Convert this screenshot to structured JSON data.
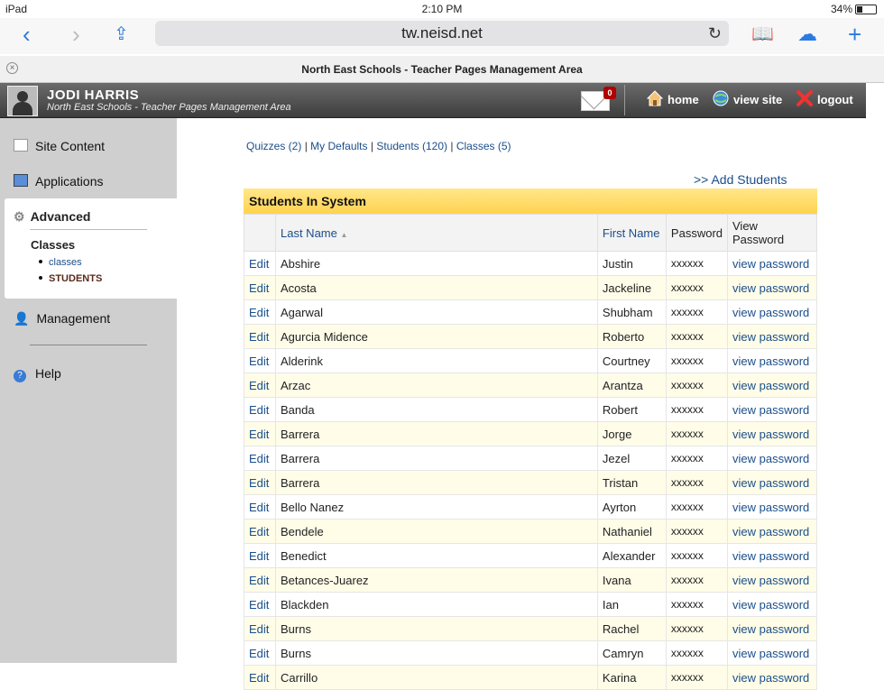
{
  "status": {
    "device": "iPad",
    "time": "2:10 PM",
    "battery": "34%"
  },
  "browser": {
    "url": "tw.neisd.net",
    "tab_title": "North East Schools - Teacher Pages Management Area"
  },
  "header": {
    "user_name": "JODI HARRIS",
    "subtitle": "North East Schools - Teacher Pages Management Area",
    "mail_count": "0",
    "home": "home",
    "view_site": "view site",
    "logout": "logout"
  },
  "sidebar": {
    "site_content": "Site Content",
    "applications": "Applications",
    "advanced": "Advanced",
    "classes_heading": "Classes",
    "sub_classes": "classes",
    "sub_students": "STUDENTS",
    "management": "Management",
    "help": "Help"
  },
  "links": {
    "quizzes": "Quizzes (2)",
    "defaults": "My Defaults",
    "students": "Students (120)",
    "classes": "Classes (5)",
    "add_students": ">> Add Students"
  },
  "table": {
    "title": "Students In System",
    "headers": {
      "last": "Last Name",
      "first": "First Name",
      "password": "Password",
      "view": "View Password"
    },
    "edit_label": "Edit",
    "masked": "xxxxxx",
    "view_label": "view password",
    "rows": [
      [
        "Abshire",
        "Justin"
      ],
      [
        "Acosta",
        "Jackeline"
      ],
      [
        "Agarwal",
        "Shubham"
      ],
      [
        "Agurcia Midence",
        "Roberto"
      ],
      [
        "Alderink",
        "Courtney"
      ],
      [
        "Arzac",
        "Arantza"
      ],
      [
        "Banda",
        "Robert"
      ],
      [
        "Barrera",
        "Jorge"
      ],
      [
        "Barrera",
        "Jezel"
      ],
      [
        "Barrera",
        "Tristan"
      ],
      [
        "Bello Nanez",
        "Ayrton"
      ],
      [
        "Bendele",
        "Nathaniel"
      ],
      [
        "Benedict",
        "Alexander"
      ],
      [
        "Betances-Juarez",
        "Ivana"
      ],
      [
        "Blackden",
        "Ian"
      ],
      [
        "Burns",
        "Rachel"
      ],
      [
        "Burns",
        "Camryn"
      ],
      [
        "Carrillo",
        "Karina"
      ]
    ]
  },
  "colors": {
    "link": "#1a4e8a",
    "caption": "#ffd24f",
    "header_bg": "#4a4a4a",
    "sidebar_bg": "#cfcfcf"
  }
}
